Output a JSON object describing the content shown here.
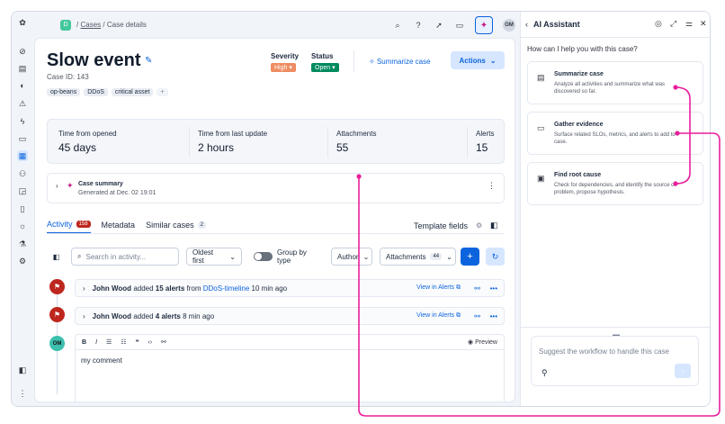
{
  "breadcrumb": {
    "space_badge": "D",
    "cases_link": "Cases",
    "separator": "/",
    "current": "Case details"
  },
  "topbar": {
    "avatar_initials": "OM"
  },
  "case": {
    "title": "Slow event",
    "case_id": "Case ID: 143",
    "tags": [
      "op-beans",
      "DDoS",
      "critical asset"
    ],
    "tags_more": "+",
    "severity_label": "Severity",
    "severity_value": "High",
    "status_label": "Status",
    "status_value": "Open",
    "summarize_label": "Summarize case",
    "actions_label": "Actions"
  },
  "stats": [
    {
      "label": "Time from opened",
      "value": "45 days"
    },
    {
      "label": "Time from last update",
      "value": "2 hours"
    },
    {
      "label": "Attachments",
      "value": "55"
    },
    {
      "label": "Alerts",
      "value": "15"
    }
  ],
  "case_summary": {
    "title": "Case summary",
    "generated": "Generated at Dec. 02 19:01"
  },
  "tabs": [
    {
      "label": "Activity",
      "count": "158"
    },
    {
      "label": "Metadata",
      "count": ""
    },
    {
      "label": "Similar cases",
      "count": "2"
    }
  ],
  "template_fields_label": "Template fields",
  "filters": {
    "search_placeholder": "Search in activity...",
    "sort": "Oldest first",
    "group_label": "Group by type",
    "author": "Author",
    "attachments": "Attachments",
    "attachments_count": "44"
  },
  "events": [
    {
      "user": "John Wood",
      "verb": "added",
      "what": "15 alerts",
      "from": "from",
      "source": "DDoS-timeline",
      "when": "10 min ago",
      "link": "View in Alerts"
    },
    {
      "user": "John Wood",
      "verb": "added",
      "what": "4 alerts",
      "from": "",
      "source": "",
      "when": "8 min ago",
      "link": "View in Alerts"
    }
  ],
  "editor": {
    "avatar": "OM",
    "preview": "Preview",
    "text": "my comment"
  },
  "ai": {
    "title": "AI Assistant",
    "question": "How can I help you with this case?",
    "cards": [
      {
        "title": "Summarize case",
        "desc": "Analyze all activities and summarize what was discovered so far."
      },
      {
        "title": "Gather evidence",
        "desc": "Surface related SLOs, metrics, and alerts to add to case."
      },
      {
        "title": "Find root cause",
        "desc": "Check for dependencies, and identify the source of problem, propose hypothesis."
      }
    ],
    "prompt_placeholder": "Suggest the workflow to handle this case"
  },
  "colors": {
    "accent": "#0b64dd",
    "annotation": "#e91e9c",
    "danger": "#bd271e",
    "success": "#008a5e"
  }
}
